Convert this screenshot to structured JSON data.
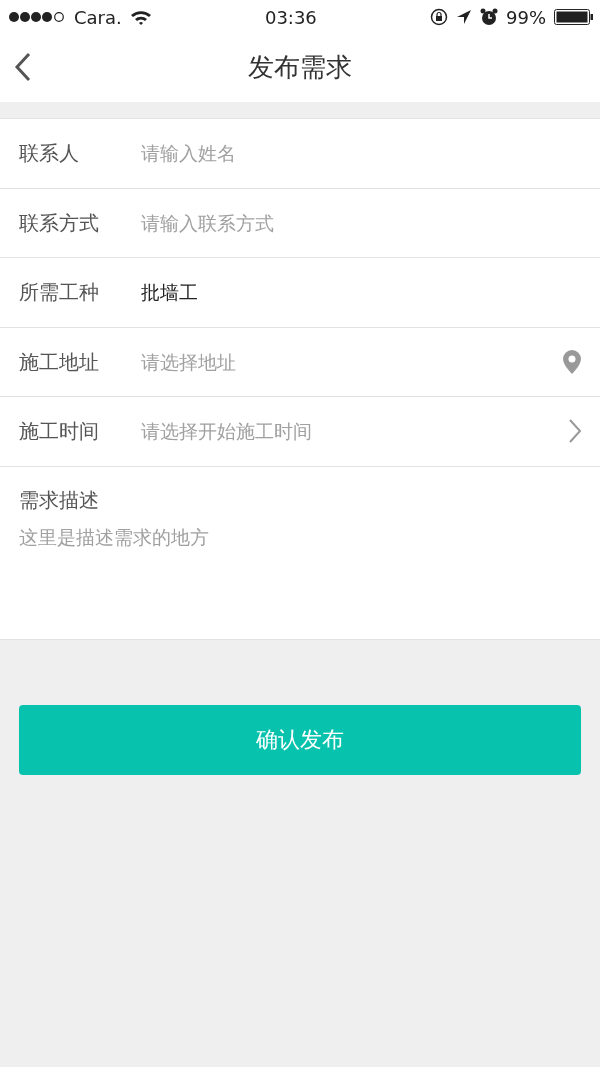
{
  "status_bar": {
    "carrier": "Cara.",
    "time": "03:36",
    "battery": "99%"
  },
  "nav": {
    "title": "发布需求"
  },
  "fields": [
    {
      "kind": "text",
      "label": "联系人",
      "placeholder": "请输入姓名"
    },
    {
      "kind": "text",
      "label": "联系方式",
      "placeholder": "请输入联系方式"
    },
    {
      "kind": "text",
      "label": "所需工种",
      "value": "批墙工"
    },
    {
      "kind": "location",
      "label": "施工地址",
      "placeholder": "请选择地址"
    },
    {
      "kind": "picker",
      "label": "施工时间",
      "placeholder": "请选择开始施工时间"
    }
  ],
  "description": {
    "label": "需求描述",
    "placeholder": "这里是描述需求的地方"
  },
  "submit_button": "确认发布"
}
